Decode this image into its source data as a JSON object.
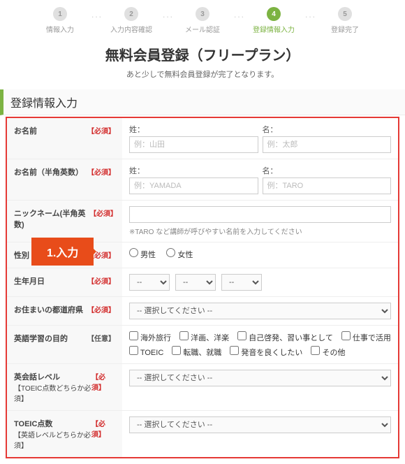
{
  "progress": {
    "steps": [
      {
        "num": "1",
        "label": "情報入力",
        "active": false
      },
      {
        "num": "2",
        "label": "入力内容確認",
        "active": false
      },
      {
        "num": "3",
        "label": "メール認証",
        "active": false
      },
      {
        "num": "4",
        "label": "登録情報入力",
        "active": true
      },
      {
        "num": "5",
        "label": "登録完了",
        "active": false
      }
    ]
  },
  "page_title": "無料会員登録（フリープラン）",
  "subtitle": "あと少しで無料会員登録が完了となります。",
  "section_header": "登録情報入力",
  "callout": "1.入力",
  "tags": {
    "required": "【必須】",
    "optional": "【任意】"
  },
  "fields": {
    "name": {
      "label": "お名前",
      "sei": "姓：",
      "mei": "名：",
      "sei_ph": "例：山田",
      "mei_ph": "例：太郎"
    },
    "name_en": {
      "label": "お名前（半角英数）",
      "sei": "姓：",
      "mei": "名：",
      "sei_ph": "例：YAMADA",
      "mei_ph": "例：TARO"
    },
    "nickname": {
      "label": "ニックネーム(半角英数)",
      "hint": "※TARO など講師が呼びやすい名前を入力してください"
    },
    "gender": {
      "label": "性別",
      "male": "男性",
      "female": "女性"
    },
    "birthday": {
      "label": "生年月日",
      "placeholder": "--"
    },
    "prefecture": {
      "label": "お住まいの都道府県",
      "placeholder": "-- 選択してください --"
    },
    "purpose": {
      "label": "英語学習の目的",
      "options": [
        "海外旅行",
        "洋画、洋楽",
        "自己啓発、習い事として",
        "仕事で活用",
        "TOEIC",
        "転職、就職",
        "発音を良くしたい",
        "その他"
      ]
    },
    "conv_level": {
      "label": "英会話レベル",
      "sub": "【TOEIC点数どちらか必須】",
      "placeholder": "-- 選択してください --"
    },
    "toeic": {
      "label": "TOEIC点数",
      "sub": "【英語レベルどちらか必須】",
      "placeholder": "-- 選択してください --"
    }
  }
}
